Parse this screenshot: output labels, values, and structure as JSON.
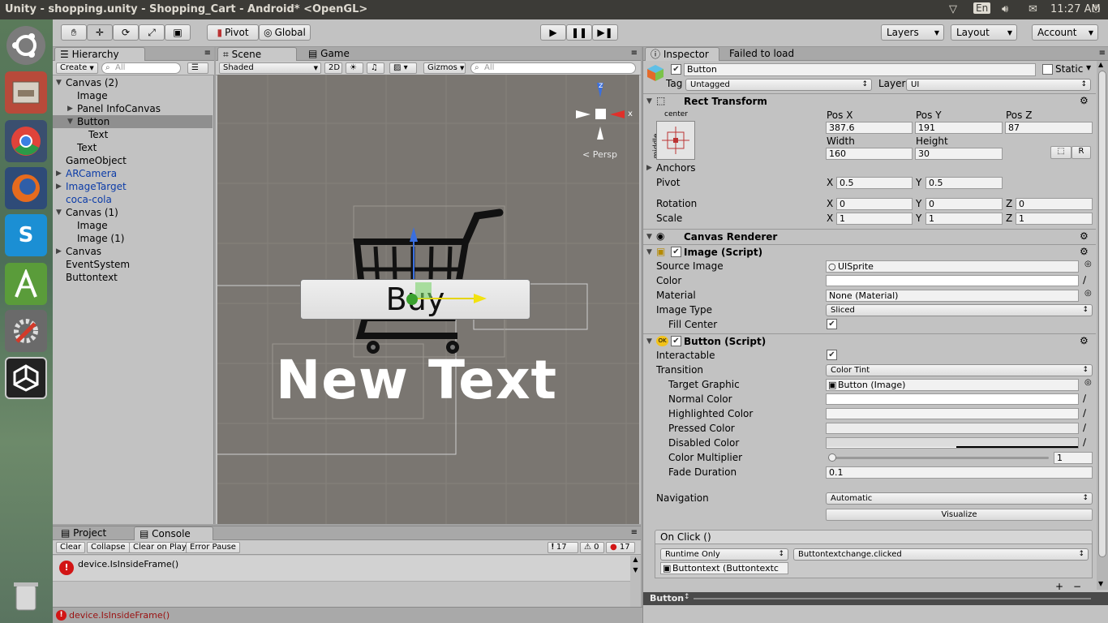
{
  "window": {
    "title": "Unity - shopping.unity - Shopping_Cart - Android* <OpenGL>",
    "lang": "En",
    "time": "11:27 AM"
  },
  "toolbar": {
    "pivot": "Pivot",
    "global": "Global",
    "layers": "Layers",
    "layout": "Layout",
    "account": "Account"
  },
  "hierarchy": {
    "tab": "Hierarchy",
    "create": "Create",
    "search_placeholder": "All",
    "items": [
      {
        "label": "Canvas (2)"
      },
      {
        "label": "Image"
      },
      {
        "label": "Panel InfoCanvas"
      },
      {
        "label": "Button"
      },
      {
        "label": "Text"
      },
      {
        "label": "Text"
      },
      {
        "label": "GameObject"
      },
      {
        "label": "ARCamera"
      },
      {
        "label": "ImageTarget"
      },
      {
        "label": "coca-cola"
      },
      {
        "label": "Canvas (1)"
      },
      {
        "label": "Image"
      },
      {
        "label": "Image (1)"
      },
      {
        "label": "Canvas"
      },
      {
        "label": "EventSystem"
      },
      {
        "label": "Buttontext"
      }
    ]
  },
  "scene": {
    "tab_scene": "Scene",
    "tab_game": "Game",
    "shading": "Shaded",
    "mode2d": "2D",
    "gizmos": "Gizmos",
    "search_placeholder": "All",
    "persp": "Persp",
    "axis_z": "z",
    "axis_x": "x",
    "button_text": "Buy",
    "new_text": "New Text"
  },
  "console": {
    "tab_project": "Project",
    "tab_console": "Console",
    "clear": "Clear",
    "collapse": "Collapse",
    "clear_on_play": "Clear on Play",
    "error_pause": "Error Pause",
    "count_log": "17",
    "count_warn": "0",
    "count_err": "17",
    "message": "device.IsInsideFrame()"
  },
  "status": {
    "message": "device.IsInsideFrame()"
  },
  "inspector": {
    "tab": "Inspector",
    "tab2": "Failed to load",
    "object_name": "Button",
    "static_label": "Static",
    "tag_label": "Tag",
    "tag_value": "Untagged",
    "layer_label": "Layer",
    "layer_value": "UI",
    "rect_transform": {
      "title": "Rect Transform",
      "anchor_h": "center",
      "anchor_v": "middle",
      "posx_label": "Pos X",
      "posy_label": "Pos Y",
      "posz_label": "Pos Z",
      "posx": "387.6",
      "posy": "191",
      "posz": "87",
      "width_label": "Width",
      "height_label": "Height",
      "width": "160",
      "height": "30",
      "r_button": "R",
      "anchors_label": "Anchors",
      "pivot_label": "Pivot",
      "pivot_x": "0.5",
      "pivot_y": "0.5",
      "rotation_label": "Rotation",
      "rot_x": "0",
      "rot_y": "0",
      "rot_z": "0",
      "scale_label": "Scale",
      "scale_x": "1",
      "scale_y": "1",
      "scale_z": "1",
      "x": "X",
      "y": "Y",
      "z": "Z"
    },
    "canvas_renderer": {
      "title": "Canvas Renderer"
    },
    "image_script": {
      "title": "Image (Script)",
      "source_image_label": "Source Image",
      "source_image": "UISprite",
      "color_label": "Color",
      "material_label": "Material",
      "material": "None (Material)",
      "image_type_label": "Image Type",
      "image_type": "Sliced",
      "fill_center_label": "Fill Center"
    },
    "button_script": {
      "title": "Button (Script)",
      "interactable_label": "Interactable",
      "transition_label": "Transition",
      "transition": "Color Tint",
      "target_graphic_label": "Target Graphic",
      "target_graphic": "Button (Image)",
      "normal_color_label": "Normal Color",
      "highlighted_color_label": "Highlighted Color",
      "pressed_color_label": "Pressed Color",
      "disabled_color_label": "Disabled Color",
      "color_multiplier_label": "Color Multiplier",
      "color_multiplier": "1",
      "color_multiplier_level": 0,
      "fade_duration_label": "Fade Duration",
      "fade_duration": "0.1",
      "navigation_label": "Navigation",
      "navigation": "Automatic",
      "visualize": "Visualize",
      "on_click_label": "On Click ()",
      "runtime": "Runtime Only",
      "function": "Buttontextchange.clicked",
      "object_ref": "Buttontext (Buttontextc"
    },
    "bottom_label": "Button"
  },
  "colors": {
    "accent_selection": "#8f8f8f",
    "error": "#d21515",
    "scene_bg": "#7a7671"
  }
}
